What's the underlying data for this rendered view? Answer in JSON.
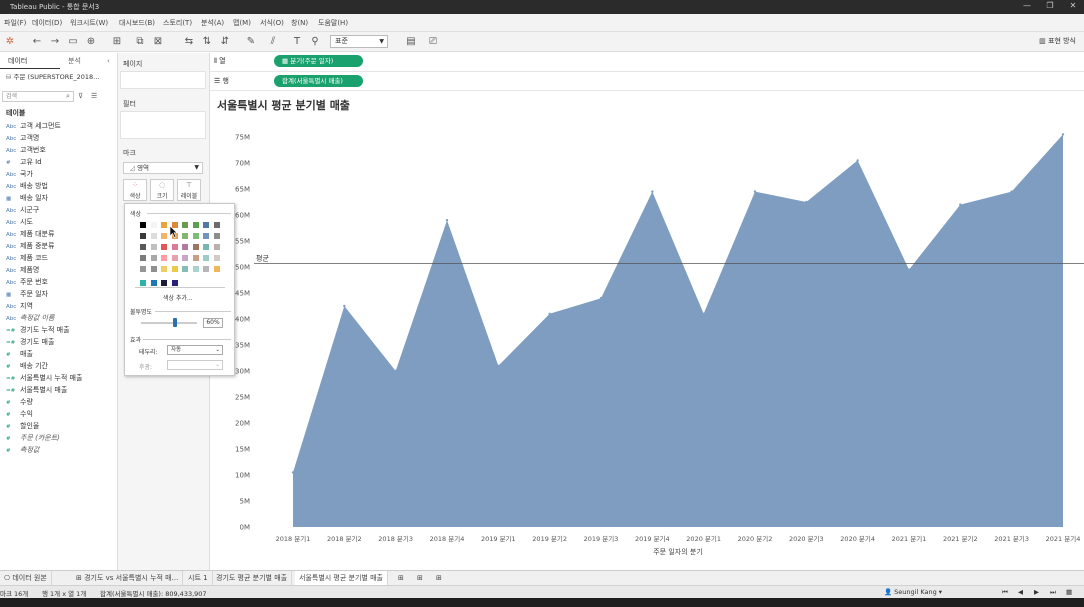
{
  "window": {
    "title": "Tableau Public - 통합 문서3"
  },
  "menu": [
    "파일(F)",
    "데이터(D)",
    "워크시트(W)",
    "대시보드(B)",
    "스토리(T)",
    "분석(A)",
    "맵(M)",
    "서식(O)",
    "창(N)",
    "도움말(H)"
  ],
  "toolbar": {
    "fit_select": "표준",
    "show_me": "표현 방식"
  },
  "data_pane": {
    "tab_data": "데이터",
    "tab_analysis": "분석",
    "datasource": "주문 (SUPERSTORE_2018...",
    "search_placeholder": "검색",
    "tables_heading": "테이블",
    "fields": [
      {
        "icon": "Abc",
        "label": "고객 세그먼트",
        "kind": "dim"
      },
      {
        "icon": "Abc",
        "label": "고객명",
        "kind": "dim"
      },
      {
        "icon": "Abc",
        "label": "고객번호",
        "kind": "dim"
      },
      {
        "icon": "#",
        "label": "고유 Id",
        "kind": "dim"
      },
      {
        "icon": "Abc",
        "label": "국가",
        "kind": "dim"
      },
      {
        "icon": "Abc",
        "label": "배송 방법",
        "kind": "dim"
      },
      {
        "icon": "▦",
        "label": "배송 일자",
        "kind": "dim"
      },
      {
        "icon": "Abc",
        "label": "시군구",
        "kind": "dim"
      },
      {
        "icon": "Abc",
        "label": "시도",
        "kind": "dim"
      },
      {
        "icon": "Abc",
        "label": "제품 대분류",
        "kind": "dim"
      },
      {
        "icon": "Abc",
        "label": "제품 중분류",
        "kind": "dim"
      },
      {
        "icon": "Abc",
        "label": "제품 코드",
        "kind": "dim"
      },
      {
        "icon": "Abc",
        "label": "제품명",
        "kind": "dim"
      },
      {
        "icon": "Abc",
        "label": "주문 번호",
        "kind": "dim"
      },
      {
        "icon": "▦",
        "label": "주문 일자",
        "kind": "dim"
      },
      {
        "icon": "Abc",
        "label": "지역",
        "kind": "dim"
      },
      {
        "icon": "Abc",
        "label": "측정값 이름",
        "kind": "dim",
        "italic": true
      },
      {
        "icon": "=#",
        "label": "경기도 누적 매출",
        "kind": "mea"
      },
      {
        "icon": "=#",
        "label": "경기도 매출",
        "kind": "mea"
      },
      {
        "icon": "#",
        "label": "매출",
        "kind": "mea"
      },
      {
        "icon": "#",
        "label": "배송 기간",
        "kind": "mea"
      },
      {
        "icon": "=#",
        "label": "서울특별시 누적 매출",
        "kind": "mea"
      },
      {
        "icon": "=#",
        "label": "서울특별시 매출",
        "kind": "mea"
      },
      {
        "icon": "#",
        "label": "수량",
        "kind": "mea"
      },
      {
        "icon": "#",
        "label": "수익",
        "kind": "mea"
      },
      {
        "icon": "#",
        "label": "할인율",
        "kind": "mea"
      },
      {
        "icon": "#",
        "label": "주문 (카운트)",
        "kind": "mea",
        "italic": true
      },
      {
        "icon": "#",
        "label": "측정값",
        "kind": "mea",
        "italic": true
      }
    ]
  },
  "cards": {
    "pages": "페이지",
    "filters": "필터",
    "marks": "마크",
    "mark_type": "영역",
    "btn_color": "색상",
    "btn_size": "크기",
    "btn_label": "레이블"
  },
  "color_popup": {
    "heading_color": "색상",
    "more_colors": "색상 추가...",
    "heading_opacity": "불투명도",
    "opacity_value": "60%",
    "heading_effects": "효과",
    "border_label": "테두리:",
    "border_value": "자동",
    "halo_label": "후광:",
    "halo_value": "",
    "swatch_colors": [
      "#000000",
      "#ffffff",
      "#e8a33d",
      "#d9983b",
      "#6b9a4e",
      "#59a14f",
      "#4e79a7",
      "#8c8c8c",
      "#4d4d4d",
      "#f0f0f0",
      "#f1ce63",
      "#e15759",
      "#b07aa1",
      "#86bcb6",
      "#9d7660",
      "#bab0ac",
      "#ff9da7",
      "#edc948",
      "#76b7b2",
      "#2bb5a9",
      "#1f77b4",
      "#1b1b6e",
      "#26207a"
    ]
  },
  "shelves": {
    "columns_label": "열",
    "rows_label": "행",
    "columns_pill": "분기(주문 일자)",
    "rows_pill": "합계(서울특별시 매출)"
  },
  "chart_data": {
    "type": "area",
    "title": "서울특별시 평균 분기별 매출",
    "xlabel": "주문 일자의 분기",
    "ylabel": "",
    "x": [
      "2018 분기1",
      "2018 분기2",
      "2018 분기3",
      "2018 분기4",
      "2019 분기1",
      "2019 분기2",
      "2019 분기3",
      "2019 분기4",
      "2020 분기1",
      "2020 분기2",
      "2020 분기3",
      "2020 분기4",
      "2021 분기1",
      "2021 분기2",
      "2021 분기3",
      "2021 분기4"
    ],
    "series": [
      {
        "values": [
          10.5,
          42.5,
          30,
          59,
          31,
          41,
          44,
          64.5,
          41,
          64.5,
          62.5,
          70.5,
          49.5,
          62,
          64.5,
          75.5
        ]
      }
    ],
    "ylim": [
      0,
      75
    ],
    "yticks": [
      "0M",
      "5M",
      "10M",
      "15M",
      "20M",
      "25M",
      "30M",
      "35M",
      "40M",
      "45M",
      "50M",
      "55M",
      "60M",
      "65M",
      "70M",
      "75M"
    ],
    "reference_line": {
      "label": "평균",
      "value": 50.7
    },
    "color": "#7e9dc0",
    "grid": false
  },
  "sheet_tabs": [
    "데이터 원본",
    "경기도 vs 서울특별시 누적 매...",
    "시트 1",
    "경기도 평균 분기별 매출",
    "서울특별시 평균 분기별 매출"
  ],
  "status": {
    "marks": "마크 16개",
    "rows_cols": "행 1개 x 열 1개",
    "sum": "합계(서울특별시 매출): 809,433,907",
    "user": "Seungil Kang"
  }
}
